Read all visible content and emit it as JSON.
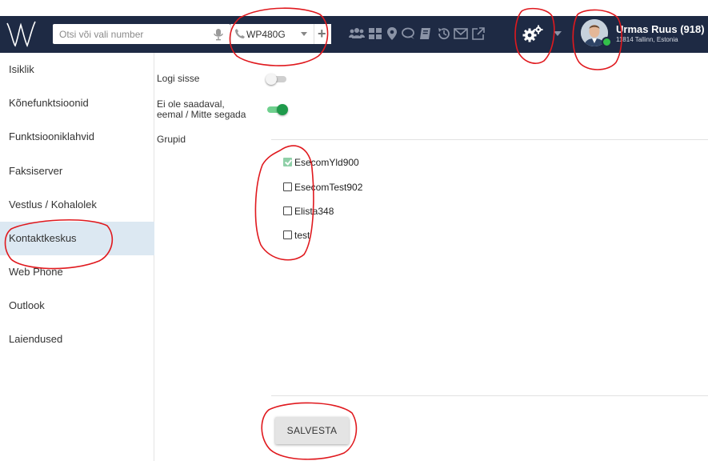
{
  "search": {
    "placeholder": "Otsi või vali number"
  },
  "device": {
    "selected": "WP480G"
  },
  "user": {
    "name": "Urmas Ruus (918)",
    "location": "11814 Tallinn, Estonia"
  },
  "sidebar": {
    "items": [
      {
        "label": "Isiklik"
      },
      {
        "label": "Kõnefunktsioonid"
      },
      {
        "label": "Funktsiooniklahvid"
      },
      {
        "label": "Faksiserver"
      },
      {
        "label": "Vestlus / Kohalolek"
      },
      {
        "label": "Kontaktkeskus",
        "active": true
      },
      {
        "label": "Web Phone"
      },
      {
        "label": "Outlook"
      },
      {
        "label": "Laiendused"
      }
    ]
  },
  "settings": {
    "login_label": "Logi sisse",
    "login_on": false,
    "away_label_line1": "Ei ole saadaval,",
    "away_label_line2": "eemal / Mitte segada",
    "away_on": true,
    "groups_label": "Grupid"
  },
  "groups": [
    {
      "name": "EsecomYld900",
      "checked": true
    },
    {
      "name": "EsecomTest902",
      "checked": false
    },
    {
      "name": "Elista348",
      "checked": false
    },
    {
      "name": "test",
      "checked": false
    }
  ],
  "save_label": "SALVESTA",
  "colors": {
    "topbar": "#1e2a44",
    "active_item": "#dce8f2",
    "toggle_on": "#1f9a4b",
    "presence": "#33c04a",
    "annotation": "#e0191e"
  }
}
